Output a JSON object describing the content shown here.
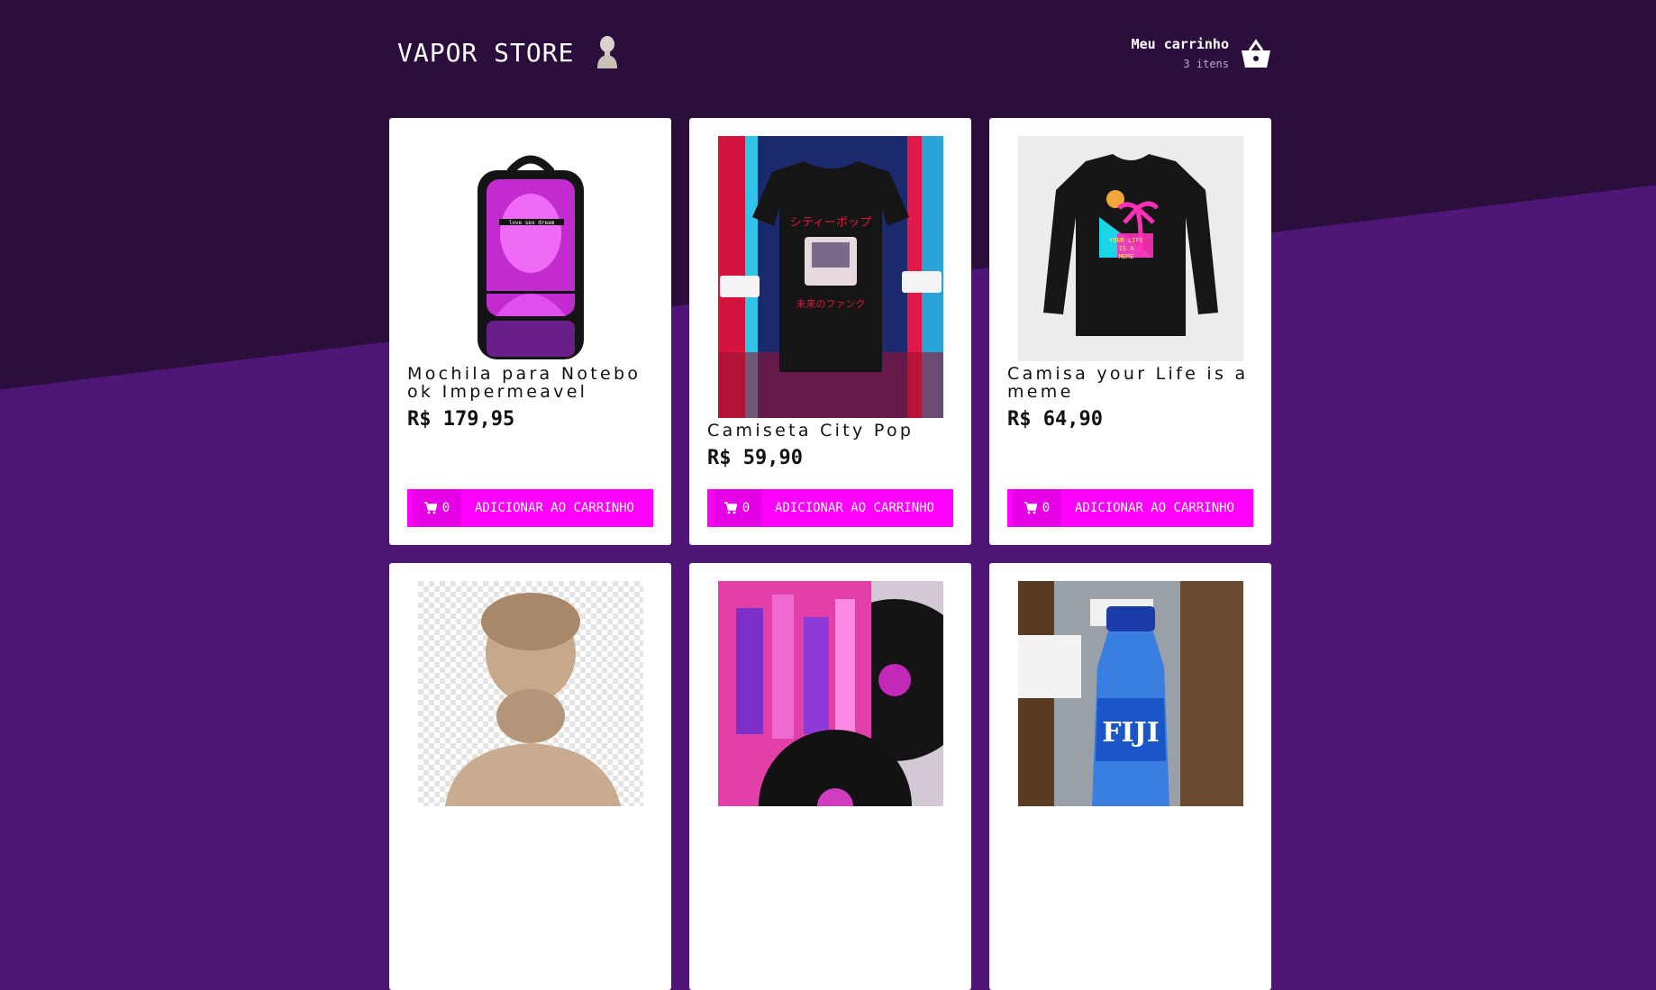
{
  "header": {
    "title": "VAPOR STORE",
    "logo_icon": "bust-icon",
    "cart": {
      "title": "Meu carrinho",
      "count": "3 itens",
      "icon": "basket-icon"
    }
  },
  "colors": {
    "bg_dark": "#2b0e3c",
    "bg_purple": "#4f1677",
    "accent": "#ff00ff"
  },
  "products": [
    {
      "name": "Mochila para Notebook Impermeavel",
      "price": "R$ 179,95",
      "qty": "0",
      "button": "ADICIONAR AO CARRINHO",
      "image": "backpack-image"
    },
    {
      "name": "Camiseta City Pop",
      "price": "R$ 59,90",
      "qty": "0",
      "button": "ADICIONAR AO CARRINHO",
      "image": "city-pop-tshirt-image"
    },
    {
      "name": "Camisa your Life is a meme",
      "price": "R$ 64,90",
      "qty": "0",
      "button": "ADICIONAR AO CARRINHO",
      "image": "longsleeve-shirt-image"
    },
    {
      "image": "marble-bust-image"
    },
    {
      "image": "vinyl-record-image"
    },
    {
      "image": "water-bottle-image"
    }
  ]
}
